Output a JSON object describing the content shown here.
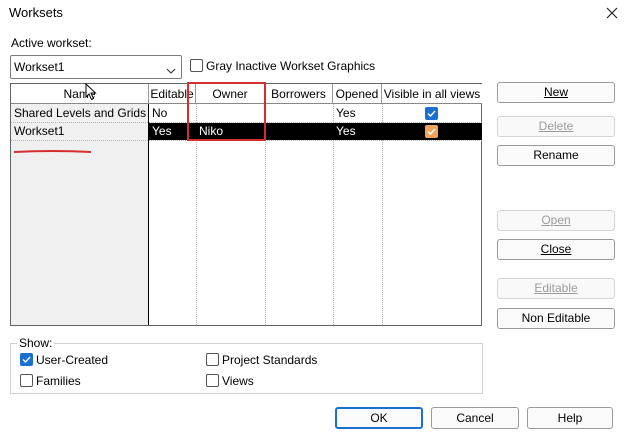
{
  "window": {
    "title": "Worksets"
  },
  "active_workset": {
    "label": "Active workset:",
    "value": "Workset1",
    "gray_inactive_label": "Gray Inactive Workset Graphics",
    "gray_inactive_checked": false
  },
  "grid": {
    "columns": [
      "Name",
      "Editable",
      "Owner",
      "Borrowers",
      "Opened",
      "Visible in all views"
    ],
    "rows": [
      {
        "name": "Shared Levels and Grids",
        "editable": "No",
        "owner": "",
        "borrowers": "",
        "opened": "Yes",
        "visible": true,
        "selected": false
      },
      {
        "name": "Workset1",
        "editable": "Yes",
        "owner": "Niko",
        "borrowers": "",
        "opened": "Yes",
        "visible": true,
        "selected": true
      }
    ]
  },
  "buttons": {
    "new": "New",
    "delete": "Delete",
    "rename": "Rename",
    "open": "Open",
    "close": "Close",
    "editable": "Editable",
    "non_editable": "Non Editable"
  },
  "show": {
    "label": "Show:",
    "user_created": "User-Created",
    "user_created_checked": true,
    "families": "Families",
    "families_checked": false,
    "project_standards": "Project Standards",
    "project_standards_checked": false,
    "views": "Views",
    "views_checked": false
  },
  "footer": {
    "ok": "OK",
    "cancel": "Cancel",
    "help": "Help"
  },
  "colors": {
    "accent": "#1b6fd1",
    "annotation": "#d32f2f",
    "checkbox_selected": "#f0a35a"
  }
}
